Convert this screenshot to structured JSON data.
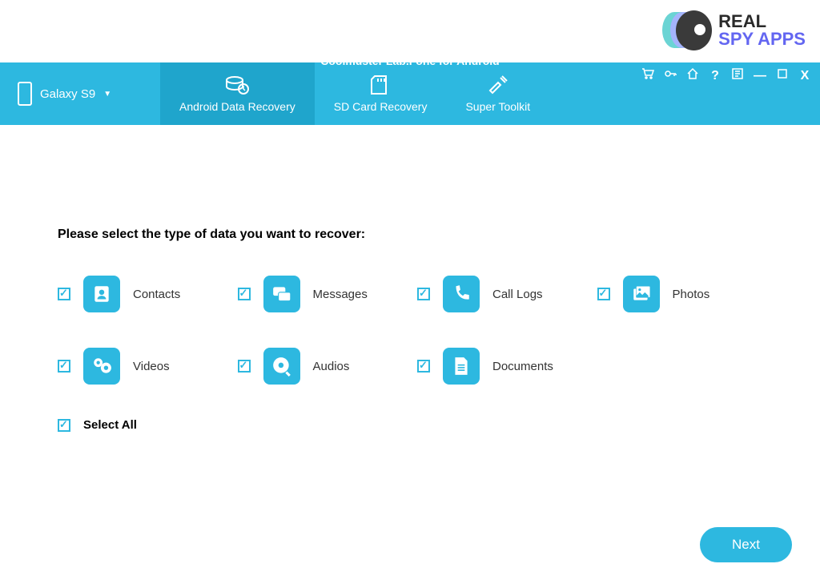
{
  "watermark": {
    "line1": "REAL",
    "line2": "SPY APPS"
  },
  "header": {
    "app_title": "Coolmuster Lab.Fone for Android",
    "device": "Galaxy S9",
    "tabs": [
      {
        "label": "Android Data Recovery",
        "active": true
      },
      {
        "label": "SD Card Recovery",
        "active": false
      },
      {
        "label": "Super Toolkit",
        "active": false
      }
    ]
  },
  "content": {
    "prompt": "Please select the type of data you want to recover:",
    "items": [
      {
        "label": "Contacts",
        "checked": true,
        "icon": "contacts"
      },
      {
        "label": "Messages",
        "checked": true,
        "icon": "messages"
      },
      {
        "label": "Call Logs",
        "checked": true,
        "icon": "calllogs"
      },
      {
        "label": "Photos",
        "checked": true,
        "icon": "photos"
      },
      {
        "label": "Videos",
        "checked": true,
        "icon": "videos"
      },
      {
        "label": "Audios",
        "checked": true,
        "icon": "audios"
      },
      {
        "label": "Documents",
        "checked": true,
        "icon": "documents"
      }
    ],
    "select_all": {
      "label": "Select All",
      "checked": true
    },
    "next_button": "Next"
  }
}
